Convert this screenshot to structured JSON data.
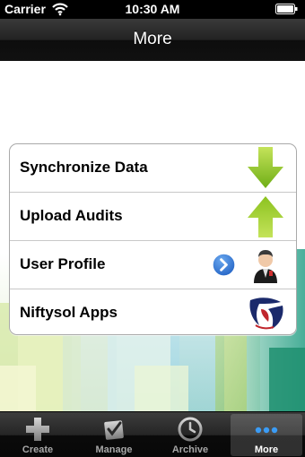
{
  "status_bar": {
    "carrier": "Carrier",
    "time": "10:30 AM",
    "wifi_icon": "wifi-icon",
    "battery_icon": "battery-icon"
  },
  "nav_bar": {
    "title": "More"
  },
  "menu": {
    "items": [
      {
        "label": "Synchronize Data",
        "icon": "download-arrow-icon"
      },
      {
        "label": "Upload Audits",
        "icon": "upload-arrow-icon"
      },
      {
        "label": "User Profile",
        "icon": "user-profile-icon",
        "accessory": "disclosure-button-icon"
      },
      {
        "label": "Niftysol Apps",
        "icon": "niftysol-logo-icon"
      }
    ]
  },
  "tab_bar": {
    "tabs": [
      {
        "label": "Create",
        "icon": "plus-icon",
        "selected": false
      },
      {
        "label": "Manage",
        "icon": "checkbox-icon",
        "selected": false
      },
      {
        "label": "Archive",
        "icon": "clock-icon",
        "selected": false
      },
      {
        "label": "More",
        "icon": "more-dots-icon",
        "selected": true
      }
    ]
  },
  "colors": {
    "arrow_green": "#8cc21f",
    "disclosure_blue": "#2a6fd0",
    "tab_selected_text": "#ffffff",
    "tab_text": "#a7a7a7"
  }
}
